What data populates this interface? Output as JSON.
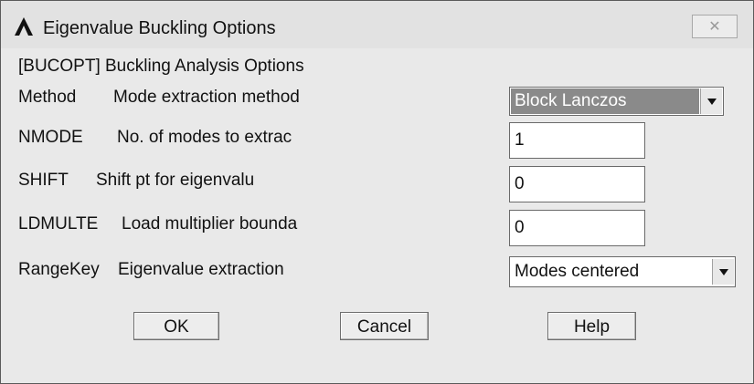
{
  "window": {
    "title": "Eigenvalue Buckling Options",
    "close_glyph": "✕"
  },
  "section_heading": "[BUCOPT]  Buckling Analysis Options",
  "fields": {
    "method": {
      "key": "Method",
      "desc": "Mode extraction method",
      "value": "Block Lanczos"
    },
    "nmode": {
      "key": "NMODE",
      "desc": "No. of modes to extrac",
      "value": "1"
    },
    "shift": {
      "key": "SHIFT",
      "desc": "Shift pt for eigenvalu",
      "value": "0"
    },
    "ldmulte": {
      "key": "LDMULTE",
      "desc": "Load multiplier bounda",
      "value": "0"
    },
    "rangekey": {
      "key": "RangeKey",
      "desc": "Eigenvalue extraction",
      "value": "Modes centered"
    }
  },
  "buttons": {
    "ok": "OK",
    "cancel": "Cancel",
    "help": "Help"
  },
  "icons": {
    "app": "ansys-logo-icon",
    "close": "close-icon",
    "dropdown": "chevron-down-icon"
  },
  "colors": {
    "window_bg": "#e9e9e9",
    "selected_bg": "#8a8a8a"
  }
}
